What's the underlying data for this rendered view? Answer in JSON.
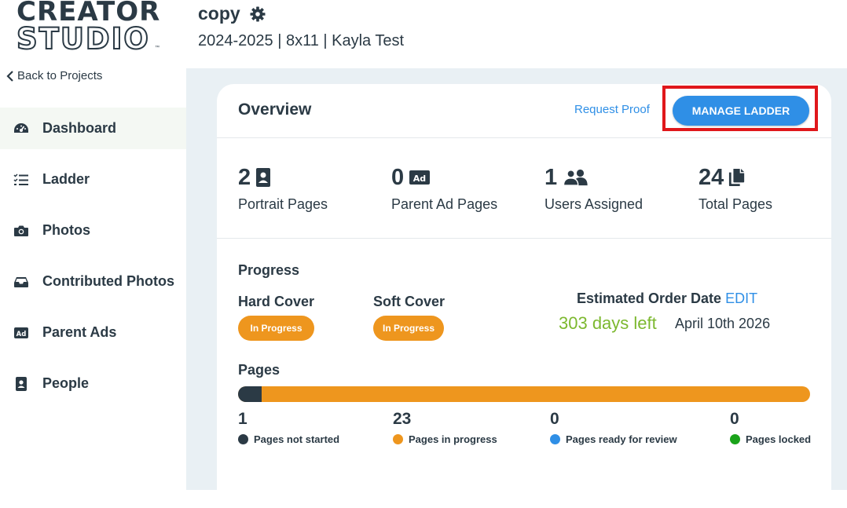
{
  "sidebar": {
    "logo_line1": "CREATOR",
    "logo_line2": "STUDIO",
    "logo_tm": "™",
    "back_label": "Back to Projects",
    "items": [
      {
        "label": "Dashboard",
        "icon": "dashboard-gauge-icon",
        "active": true
      },
      {
        "label": "Ladder",
        "icon": "list-check-icon"
      },
      {
        "label": "Photos",
        "icon": "camera-icon"
      },
      {
        "label": "Contributed Photos",
        "icon": "inbox-tray-icon"
      },
      {
        "label": "Parent Ads",
        "icon": "ad-icon"
      },
      {
        "label": "People",
        "icon": "person-badge-icon"
      }
    ]
  },
  "header": {
    "title": "copy",
    "subtitle": "2024-2025 | 8x11 | Kayla Test"
  },
  "overview": {
    "title": "Overview",
    "request_proof": "Request Proof",
    "manage_ladder": "MANAGE LADDER",
    "stats": [
      {
        "value": "2",
        "label": "Portrait Pages",
        "icon": "portrait-icon"
      },
      {
        "value": "0",
        "label": "Parent Ad Pages",
        "icon": "ad-icon"
      },
      {
        "value": "1",
        "label": "Users Assigned",
        "icon": "users-icon"
      },
      {
        "value": "24",
        "label": "Total Pages",
        "icon": "pages-icon"
      }
    ]
  },
  "progress": {
    "title": "Progress",
    "hard_cover": {
      "label": "Hard Cover",
      "status": "In Progress"
    },
    "soft_cover": {
      "label": "Soft Cover",
      "status": "In Progress"
    },
    "estimated_label": "Estimated Order Date",
    "edit_label": "EDIT",
    "days_left": "303 days left",
    "order_date": "April 10th 2026"
  },
  "pages": {
    "title": "Pages",
    "total": 24,
    "items": [
      {
        "count": "1",
        "label": "Pages not started",
        "color": "#2b3a45"
      },
      {
        "count": "23",
        "label": "Pages in progress",
        "color": "#ee961e"
      },
      {
        "count": "0",
        "label": "Pages ready for review",
        "color": "#2f8fe6"
      },
      {
        "count": "0",
        "label": "Pages locked",
        "color": "#1aa31a"
      }
    ]
  },
  "colors": {
    "accent": "#2f8fe6",
    "orange": "#ee961e",
    "green": "#7cb82f",
    "dark": "#2b3a45",
    "highlight": "#e0171b"
  }
}
